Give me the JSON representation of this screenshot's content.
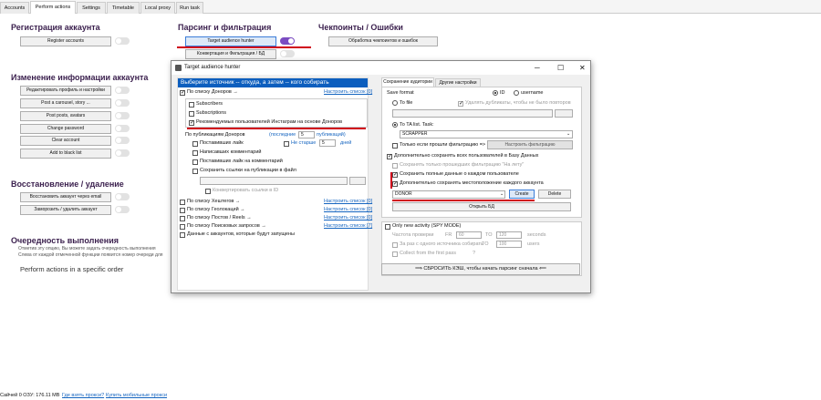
{
  "tabs": [
    "Accounts",
    "Perform actions",
    "Settings",
    "Timetable",
    "Local proxy",
    "Run task"
  ],
  "left": {
    "reg_title": "Регистрация аккаунта",
    "register_btn": "Register accounts",
    "change_title": "Изменение информации аккаунта",
    "change_btns": [
      "Редактировать профиль и настройки",
      "Post a carousel, story ...",
      "Post posts, avatars",
      "Change password",
      "Clear account",
      "Add to black list"
    ],
    "restore_title": "Восстановление / удаление",
    "restore_btns": [
      "Восстановить аккаунт через email",
      "Заморозить / удалить аккаунт"
    ],
    "order_title": "Очередность выполнения",
    "order_desc1": "Отметив эту опцию, Вы можете задать очередность выполнения",
    "order_desc2": "Слева от каждой отмеченной функции появится номер очереди для",
    "order_opt": "Perform actions in a specific order"
  },
  "mid": {
    "parse_title": "Парсинг и фильтрация",
    "tah_btn": "Target audience hunter",
    "conv_btn": "Конвертация и Фильтрация / БД",
    "check_title": "Чекпоинты / Ошибки",
    "check_btn": "Обработка чекпоинтов и ошибок"
  },
  "win": {
    "title": "Target audience hunter",
    "header": "Выберите источник -- откуда, а затем -- кого собирать",
    "donors": "По списку Доноров →",
    "cfg_list": "Настроить список [0]",
    "subs": "Subscribers",
    "subscriptions": "Subscriptions",
    "recommended": "Рекомендуемых пользователей Инстаграм на основе Доноров",
    "by_pubs": "По публикациям Доноров",
    "last": "(последние",
    "last_n": "5",
    "pubs": "публикаций)",
    "liked": "Поставивших лайк",
    "not_older": "Не старше",
    "days_n": "5",
    "days": "дней",
    "commented": "Написавших комментарий",
    "liked_comment": "Поставивших лайк на комментарий",
    "save_links": "Сохранить ссылки на публикации в файл",
    "convert_links": "Конвертировать ссылки в ID",
    "hashtags": "По списку Хештегов →",
    "geo": "По списку Геолокаций →",
    "posts_reels": "По списку Постов / Reels →",
    "searches": "По списку Поисковых запросов →",
    "cfg_list7": "Настроить список [7]",
    "fetched": "Данные с аккаунтов, которые будут запущены",
    "rtab1": "Сохранение аудитории",
    "rtab2": "Другие настройки",
    "save_format": "Save format",
    "id": "ID",
    "username": "username",
    "to_file": "To file",
    "remove_dup": "Удалять дубликаты, чтобы не было повторов",
    "to_ta": "To TA list. Task:",
    "task": "SCRAPPER",
    "only_filtered": "Только если прошли фильтрацию =>",
    "cfg_filter": "Настроить фильтрацию",
    "extra_save": "Дополнительно сохранять всех пользователей в Базу Данных",
    "save_only_passed": "Сохранять только прошедших фильтрацию \"На лету\"",
    "save_full": "Сохранить полные данные о каждом пользователе",
    "save_loc": "Дополнительно сохранять местоположение каждого аккаунта",
    "db_name": "DONOR",
    "create": "Create",
    "delete": "Delete",
    "open_db": "Открыть БД",
    "only_new": "Only new activity (SPY MODE)",
    "freq": "Частота проверки",
    "fr": "FR",
    "fr_v": "60",
    "to": "TO",
    "to_v": "120",
    "seconds": "seconds",
    "per_run": "За раз с одного источника собирать",
    "to2_v": "100",
    "users": "users",
    "collect_first": "Collect from the first pass",
    "q": "?",
    "reset": "⟹ СБРОСИТЬ КЭШ, чтобы начать парсинг сначала ⟸"
  },
  "status": {
    "text": "Сайчей 0   ОЗУ: 176.11 MB",
    "link1": "Где взять прокси?",
    "link2": "Купить мобильные прокси"
  }
}
